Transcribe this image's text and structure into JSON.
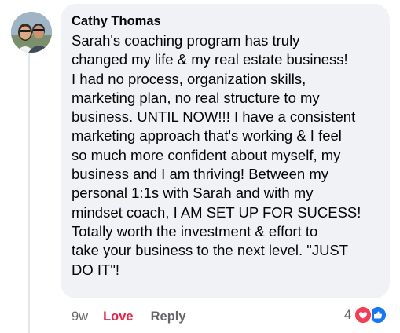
{
  "comment": {
    "author": "Cathy Thomas",
    "text": "Sarah's coaching program has truly\nchanged my life & my real estate business!\nI had no process, organization skills,\nmarketing plan, no real structure to my\nbusiness. UNTIL NOW!!! I have a consistent\nmarketing approach that's working & I feel\nso much more confident about myself, my\nbusiness and I am thriving! Between my\npersonal 1:1s with Sarah and with my\nmindset coach, I AM SET UP FOR SUCESS!\nTotally worth the investment & effort to\ntake your business to the next level. \"JUST\nDO IT\"!",
    "timestamp": "9w",
    "love_label": "Love",
    "reply_label": "Reply",
    "reaction_count": "4",
    "reactions": [
      "love-icon",
      "like-icon"
    ]
  },
  "colors": {
    "bubble_bg": "#f0f2f5",
    "love_red": "#e4254c",
    "like_blue": "#1877f2",
    "meta_gray": "#65676b"
  }
}
